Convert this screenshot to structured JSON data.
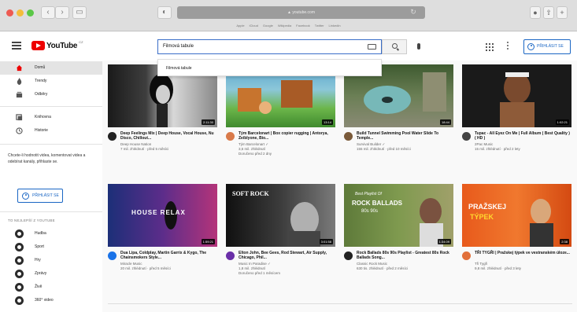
{
  "browser": {
    "url": "▲ youtube.com",
    "bookmarks": [
      "Apple",
      "iCloud",
      "Google",
      "Wikipedia",
      "Facebook",
      "Twitter",
      "LinkedIn"
    ]
  },
  "header": {
    "logo_text": "YouTube",
    "logo_suffix": "CZ",
    "search_value": "Filmová tabule",
    "suggestion": "Filmová tabule",
    "signin_label": "PŘIHLÁSIT SE"
  },
  "sidebar": {
    "items": [
      {
        "label": "Domů"
      },
      {
        "label": "Trendy"
      },
      {
        "label": "Odběry"
      },
      {
        "label": "Knihovna"
      },
      {
        "label": "Historie"
      }
    ],
    "promo_text": "Chcete-li hodnotit videa, komentovat videa a odebírat kanály, přihlaste se.",
    "signin_label": "PŘIHLÁSIT SE",
    "section_heading": "TO NEJLEPŠÍ Z YOUTUBE",
    "categories": [
      {
        "label": "Hudba"
      },
      {
        "label": "Sport"
      },
      {
        "label": "Hry"
      },
      {
        "label": "Zprávy"
      },
      {
        "label": "Živě"
      },
      {
        "label": "360° video"
      }
    ]
  },
  "videos": [
    {
      "title": "Deep Feelings Mix | Deep House, Vocal House, Nu Disco, Chillout...",
      "channel": "Deep House Nation",
      "meta1": "7 mil. zhlédnutí · před 5 měsíci",
      "meta2": "",
      "duration": "2:11:30"
    },
    {
      "title": "Tým Barcelonart | Box copier rugging | Antorya, Zeiblyone, Bio...",
      "channel": "Tým Barcelonart ✓",
      "meta1": "3,5 mil. zhlédnutí",
      "meta2": "Doručeno před 2 dny",
      "duration": "13:14"
    },
    {
      "title": "Build Tunnel Swimming Pool Water Slide To Temple...",
      "channel": "Survival Builder ✓",
      "meta1": "155 mil. zhlédnutí · před 10 měsíci",
      "meta2": "",
      "duration": "18:44"
    },
    {
      "title": "Tupac - All Eyez On Me | Full Album ( Best Quality ) ( HD )",
      "channel": "2Pac Music",
      "meta1": "15 mil. zhlédnutí · před 2 lety",
      "meta2": "",
      "duration": "1:02:21"
    },
    {
      "title": "Dua Lipa, Coldplay, Martin Garrix & Kygo, The Chainsmokers Style...",
      "channel": "Miracle Music",
      "meta1": "20 mil. zhlédnutí · před 5 měsíci",
      "meta2": "",
      "duration": "1:59:21"
    },
    {
      "title": "Elton John, Bee Gees, Rod Stewart, Air Supply, Chicago, Phil...",
      "channel": "Music In Paradise ✓",
      "meta1": "1,8 mil. zhlédnutí",
      "meta2": "Doručeno před 1 měsícem",
      "duration": "3:01:58"
    },
    {
      "title": "Rock Ballads 80s 90s Playlist - Greatest 80s Rock Ballads Song...",
      "channel": "Classic Rock Music",
      "meta1": "630 tis. zhlédnutí · před 2 měsíci",
      "meta2": "",
      "duration": "1:34:09"
    },
    {
      "title": "TŘI TYGŘI | Pražskej týpek ve vestranském úloze...",
      "channel": "Tři Tygři",
      "meta1": "9,8 mil. zhlédnutí · před 3 lety",
      "meta2": "",
      "duration": "2:38"
    }
  ],
  "thumb_text": {
    "v5": "HOUSE RELAX",
    "v6": "SOFT ROCK",
    "v7a": "Best Playlist Of",
    "v7b": "ROCK BALLADS",
    "v7c": "80s 90s",
    "v8a": "PRAŽSKEJ",
    "v8b": "TÝPEK"
  },
  "colors": {
    "accent": "#1a66c4",
    "brand_red": "#e00000"
  }
}
